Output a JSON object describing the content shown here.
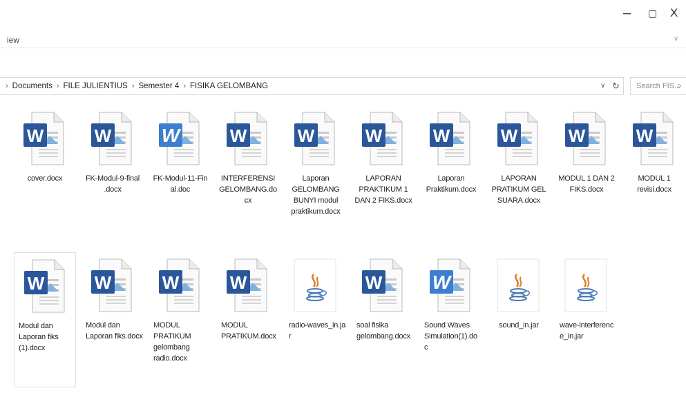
{
  "window": {
    "minimize": "–",
    "maximize": "▢",
    "close": "X"
  },
  "ribbon": {
    "view_tab": "iew",
    "expand": "∨"
  },
  "address": {
    "lead_chevron": "›",
    "crumbs": [
      "Documents",
      "FILE JULIENTIUS",
      "Semester 4",
      "FISIKA GELOMBANG"
    ],
    "dropdown": "∨",
    "refresh": "↻"
  },
  "search": {
    "placeholder": "Search FIS...",
    "icon": "search-icon"
  },
  "files": [
    {
      "name": "cover.docx",
      "type": "word"
    },
    {
      "name": "FK-Modul-9-final.docx",
      "type": "word"
    },
    {
      "name": "FK-Modul-11-Final.doc",
      "type": "word-old"
    },
    {
      "name": "INTERFERENSI GELOMBANG.docx",
      "type": "word"
    },
    {
      "name": "Laporan GELOMBANG BUNYI modul praktikum.docx",
      "type": "word"
    },
    {
      "name": "LAPORAN PRAKTIKUM 1 DAN 2 FIKS.docx",
      "type": "word"
    },
    {
      "name": "Laporan Praktikum.docx",
      "type": "word"
    },
    {
      "name": "LAPORAN PRATIKUM GEL SUARA.docx",
      "type": "word"
    },
    {
      "name": "MODUL 1 DAN 2 FIKS.docx",
      "type": "word"
    },
    {
      "name": "MODUL 1 revisi.docx",
      "type": "word"
    },
    {
      "name": "Modul dan Laporan fiks (1).docx",
      "type": "word",
      "selected": true
    },
    {
      "name": "Modul dan Laporan fiks.docx",
      "type": "word"
    },
    {
      "name": "MODUL PRATIKUM gelombang radio.docx",
      "type": "word"
    },
    {
      "name": "MODUL PRATIKUM.docx",
      "type": "word"
    },
    {
      "name": "radio-waves_in.jar",
      "type": "jar"
    },
    {
      "name": "soal fisika gelombang.docx",
      "type": "word"
    },
    {
      "name": "Sound Waves Simulation(1).doc",
      "type": "word-old"
    },
    {
      "name": "sound_in.jar",
      "type": "jar"
    },
    {
      "name": "wave-interference_in.jar",
      "type": "jar"
    }
  ],
  "labels": [
    "cover.docx",
    "FK-Modul-9-final\n.docx",
    "FK-Modul-11-Fin\nal.doc",
    "INTERFERENSI\nGELOMBANG.do\ncx",
    "Laporan\nGELOMBANG\nBUNYI modul\npraktikum.docx",
    "LAPORAN\nPRAKTIKUM 1\nDAN 2 FIKS.docx",
    "Laporan\nPraktikum.docx",
    "LAPORAN\nPRATIKUM GEL\nSUARA.docx",
    "MODUL 1 DAN 2\nFIKS.docx",
    "MODUL 1\nrevisi.docx",
    "Modul dan\nLaporan fiks\n(1).docx",
    "Modul dan\nLaporan fiks.docx",
    "MODUL\nPRATIKUM\ngelombang\nradio.docx",
    "MODUL\nPRATIKUM.docx",
    "radio-waves_in.ja\nr",
    "soal fisika\ngelombang.docx",
    "Sound Waves\nSimulation(1).do\nc",
    "sound_in.jar",
    "wave-interferenc\ne_in.jar"
  ],
  "colors": {
    "word_blue": "#2b579a",
    "word_old_blue": "#3c7fd0",
    "selection_border": "#cfe3f7",
    "java_orange": "#e07a1f",
    "java_blue": "#4a7cb4"
  }
}
